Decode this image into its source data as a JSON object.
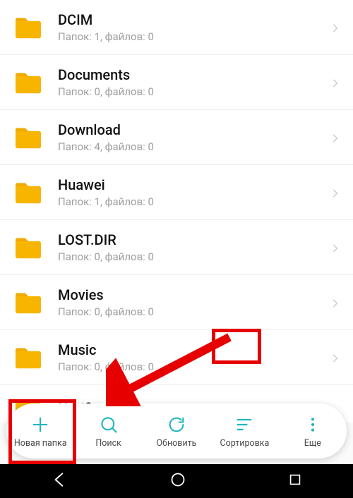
{
  "colors": {
    "accent": "#22b6be",
    "icon_folder": "#f7b500",
    "red": "#e60000"
  },
  "folders": [
    {
      "name": "DCIM",
      "folders": 1,
      "files": 0
    },
    {
      "name": "Documents",
      "folders": 0,
      "files": 0
    },
    {
      "name": "Download",
      "folders": 4,
      "files": 0
    },
    {
      "name": "Huawei",
      "folders": 1,
      "files": 0
    },
    {
      "name": "LOST.DIR",
      "folders": 0,
      "files": 0
    },
    {
      "name": "Movies",
      "folders": 0,
      "files": 0
    },
    {
      "name": "Music",
      "folders": 0,
      "files": 0
    },
    {
      "name": "Notifications",
      "folders": null,
      "files": null
    }
  ],
  "meta_labels": {
    "folders": "Папок",
    "files": "файлов"
  },
  "toolbar": {
    "new_folder": "Новая папка",
    "search": "Поиск",
    "refresh": "Обновить",
    "sort": "Сортировка",
    "more": "Еще"
  }
}
